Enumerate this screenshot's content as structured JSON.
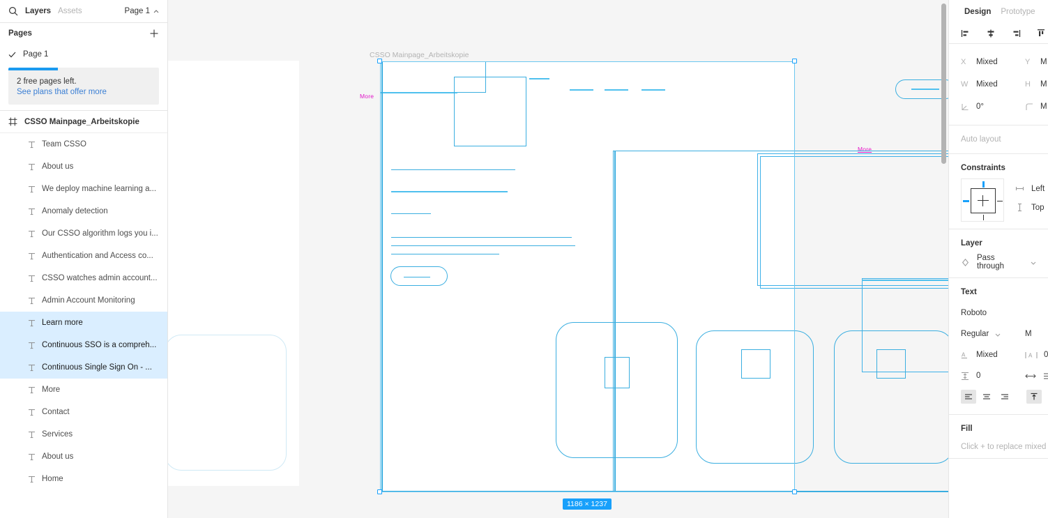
{
  "left_panel": {
    "search_icon": "search-icon",
    "tabs": [
      {
        "label": "Layers",
        "active": true
      },
      {
        "label": "Assets",
        "active": false
      }
    ],
    "page_selector": {
      "label": "Page 1",
      "icon": "chevron-up-icon"
    },
    "pages": {
      "title": "Pages",
      "add_icon": "plus-icon",
      "items": [
        {
          "label": "Page 1",
          "checked": true,
          "check_icon": "check-icon"
        }
      ]
    },
    "promo": {
      "line1": "2 free pages left.",
      "link": "See plans that offer more",
      "progress_pct": 33,
      "accent": "#1a9af0"
    },
    "layer_tree": {
      "root": {
        "label": "CSSO Mainpage_Arbeitskopie",
        "icon": "frame-icon"
      },
      "items": [
        {
          "label": "Team CSSO",
          "icon": "text-layer-icon",
          "selected": false
        },
        {
          "label": "About us",
          "icon": "text-layer-icon",
          "selected": false
        },
        {
          "label": "We deploy machine learning a...",
          "icon": "text-layer-icon",
          "selected": false
        },
        {
          "label": "Anomaly detection",
          "icon": "text-layer-icon",
          "selected": false
        },
        {
          "label": "Our CSSO algorithm logs you i...",
          "icon": "text-layer-icon",
          "selected": false
        },
        {
          "label": "Authentication and Access co...",
          "icon": "text-layer-icon",
          "selected": false
        },
        {
          "label": "CSSO watches admin account...",
          "icon": "text-layer-icon",
          "selected": false
        },
        {
          "label": "Admin Account Monitoring",
          "icon": "text-layer-icon",
          "selected": false
        },
        {
          "label": "Learn more",
          "icon": "text-layer-icon",
          "selected": true
        },
        {
          "label": "Continuous SSO is a compreh...",
          "icon": "text-layer-icon",
          "selected": true
        },
        {
          "label": "Continuous Single Sign On - ...",
          "icon": "text-layer-icon",
          "selected": true
        },
        {
          "label": "More",
          "icon": "text-layer-icon",
          "selected": false
        },
        {
          "label": "Contact",
          "icon": "text-layer-icon",
          "selected": false
        },
        {
          "label": "Services",
          "icon": "text-layer-icon",
          "selected": false
        },
        {
          "label": "About us",
          "icon": "text-layer-icon",
          "selected": false
        },
        {
          "label": "Home",
          "icon": "text-layer-icon",
          "selected": false
        }
      ]
    }
  },
  "canvas": {
    "background": "#f5f5f5",
    "frame_label": "CSSO Mainpage_Arbeitskopie",
    "selection_size_badge": "1186 × 1237",
    "selection_color": "#18a0fb",
    "wireframe_stroke": "#3aaee0",
    "more_text_left": "More",
    "more_text_main": "More",
    "more_text_color": "#e018c8",
    "scrollbar": "vertical-scrollbar"
  },
  "right_panel": {
    "tabs": [
      {
        "label": "Design",
        "active": true
      },
      {
        "label": "Prototype",
        "active": false
      }
    ],
    "align_icons": [
      "align-left-icon",
      "align-horizontal-center-icon",
      "align-right-icon",
      "align-top-icon"
    ],
    "transform": {
      "x": {
        "key": "X",
        "value": "Mixed"
      },
      "y": {
        "key": "Y",
        "value": "M"
      },
      "w": {
        "key": "W",
        "value": "Mixed"
      },
      "h": {
        "key": "H",
        "value": "M"
      },
      "rotation": {
        "icon": "rotation-icon",
        "value": "0°"
      },
      "corner_radius": {
        "icon": "corner-radius-icon",
        "value": "M"
      }
    },
    "auto_layout": {
      "label": "Auto layout",
      "add_icon": "plus-icon"
    },
    "constraints": {
      "title": "Constraints",
      "horizontal": {
        "icon": "horizontal-constraint-icon",
        "value": "Left"
      },
      "vertical": {
        "icon": "vertical-constraint-icon",
        "value": "Top"
      }
    },
    "layer": {
      "title": "Layer",
      "blend_icon": "blend-mode-icon",
      "blend_mode": "Pass through",
      "chevron": "chevron-down-icon"
    },
    "text": {
      "title": "Text",
      "font_family": "Roboto",
      "font_style": "Regular",
      "font_size": "M",
      "line_height": {
        "icon": "line-height-icon",
        "value": "Mixed"
      },
      "letter_spacing": {
        "icon": "letter-spacing-icon",
        "value": "0"
      },
      "paragraph_spacing": {
        "icon": "paragraph-spacing-icon",
        "value": "0"
      },
      "resize_icon": "horizontal-resize-icon",
      "align_h": [
        {
          "icon": "text-align-left-icon",
          "active": true
        },
        {
          "icon": "text-align-center-icon",
          "active": false
        },
        {
          "icon": "text-align-right-icon",
          "active": false
        }
      ],
      "align_v": [
        {
          "icon": "text-align-top-icon",
          "active": true
        },
        {
          "icon": "text-align-middle-icon",
          "active": false
        }
      ]
    },
    "fill": {
      "title": "Fill",
      "hint": "Click + to replace mixed"
    }
  }
}
